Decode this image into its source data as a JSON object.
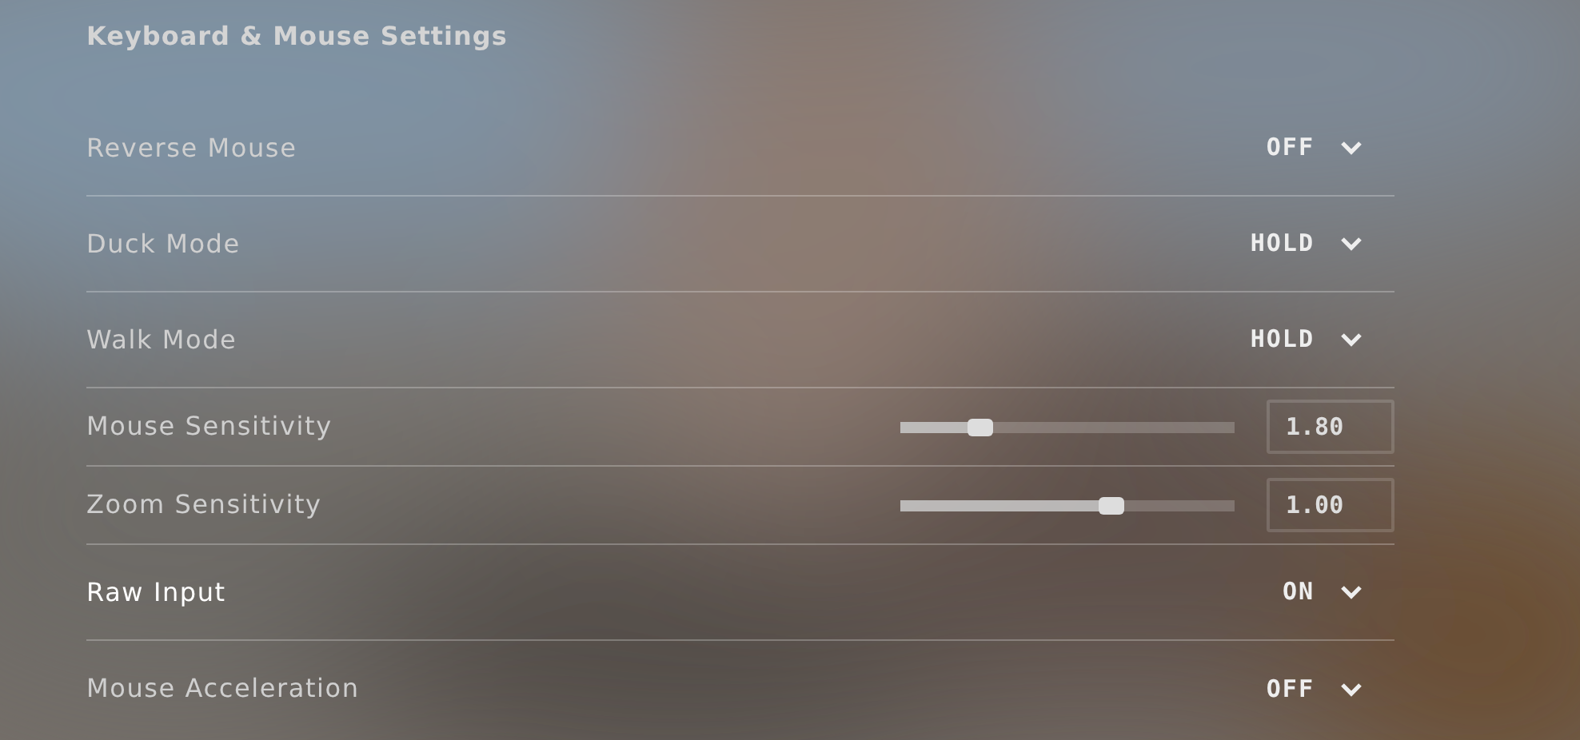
{
  "title": "Keyboard & Mouse Settings",
  "settings": [
    {
      "kind": "dropdown",
      "label": "Reverse Mouse",
      "value": "OFF",
      "hovered": false
    },
    {
      "kind": "dropdown",
      "label": "Duck Mode",
      "value": "HOLD",
      "hovered": false
    },
    {
      "kind": "dropdown",
      "label": "Walk Mode",
      "value": "HOLD",
      "hovered": false
    },
    {
      "kind": "slider",
      "label": "Mouse Sensitivity",
      "level": 0.24,
      "value": "1.80",
      "hovered": false
    },
    {
      "kind": "slider",
      "label": "Zoom Sensitivity",
      "level": 0.63,
      "value": "1.00",
      "hovered": false
    },
    {
      "kind": "dropdown",
      "label": "Raw Input",
      "value": "ON",
      "hovered": true
    },
    {
      "kind": "dropdown",
      "label": "Mouse Acceleration",
      "value": "OFF",
      "hovered": false
    }
  ]
}
